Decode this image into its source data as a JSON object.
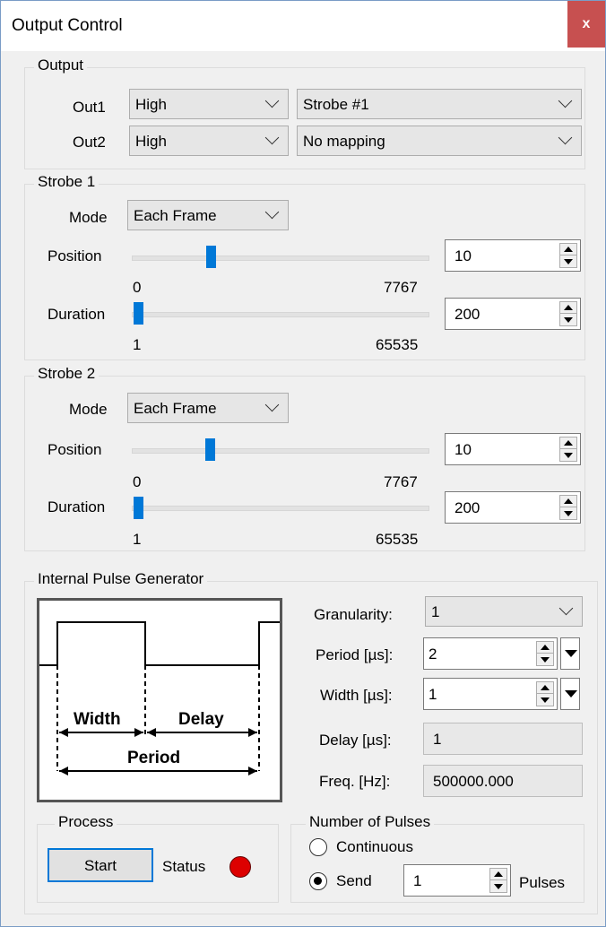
{
  "window": {
    "title": "Output Control",
    "close_label": "x"
  },
  "output": {
    "group_label": "Output",
    "rows": [
      {
        "label": "Out1",
        "level": "High",
        "mapping": "Strobe #1"
      },
      {
        "label": "Out2",
        "level": "High",
        "mapping": "No mapping"
      }
    ]
  },
  "strobes": [
    {
      "group_label": "Strobe 1",
      "mode_label": "Mode",
      "mode": "Each Frame",
      "position_label": "Position",
      "position_value": "10",
      "position_min": "0",
      "position_max": "7767",
      "duration_label": "Duration",
      "duration_value": "200",
      "duration_min": "1",
      "duration_max": "65535"
    },
    {
      "group_label": "Strobe 2",
      "mode_label": "Mode",
      "mode": "Each Frame",
      "position_label": "Position",
      "position_value": "10",
      "position_min": "0",
      "position_max": "7767",
      "duration_label": "Duration",
      "duration_value": "200",
      "duration_min": "1",
      "duration_max": "65535"
    }
  ],
  "pulse": {
    "group_label": "Internal Pulse Generator",
    "diagram": {
      "width": "Width",
      "delay": "Delay",
      "period": "Period"
    },
    "granularity_label": "Granularity:",
    "granularity": "1",
    "period_label": "Period [µs]:",
    "period": "2",
    "width_label": "Width [µs]:",
    "width": "1",
    "delay_label": "Delay [µs]:",
    "delay": "1",
    "freq_label": "Freq. [Hz]:",
    "freq": "500000.000"
  },
  "process": {
    "group_label": "Process",
    "start_label": "Start",
    "status_label": "Status",
    "status_color": "#dd0000"
  },
  "pulses": {
    "group_label": "Number of Pulses",
    "continuous_label": "Continuous",
    "send_label": "Send",
    "count": "1",
    "unit_label": "Pulses",
    "selected": "Send"
  }
}
